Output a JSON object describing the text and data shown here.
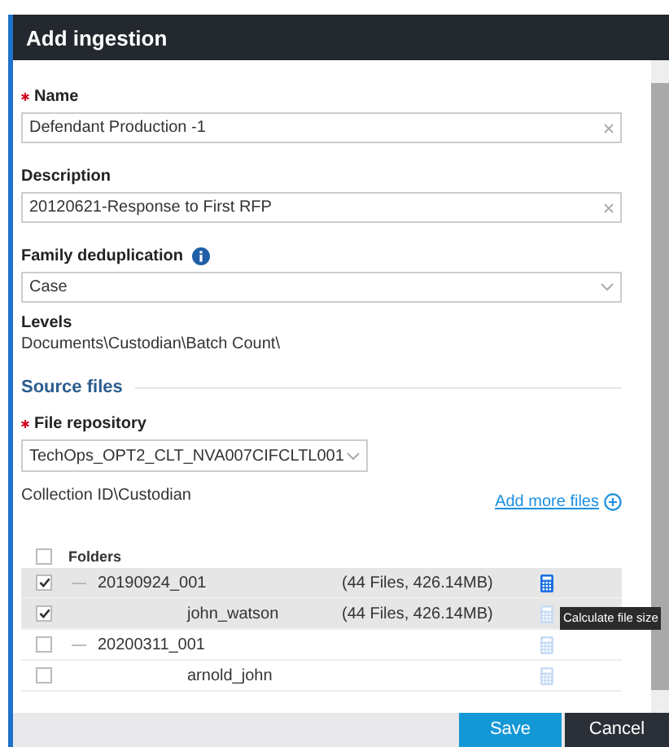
{
  "dialog": {
    "title": "Add ingestion"
  },
  "fields": [
    {
      "kind": "text",
      "label": "Name",
      "required": true,
      "value": "Defendant Production -1"
    },
    {
      "kind": "text",
      "label": "Description",
      "required": false,
      "value": "20120621-Response to First RFP"
    },
    {
      "kind": "select",
      "label": "Family deduplication",
      "required": false,
      "info": true,
      "value": "Case"
    }
  ],
  "levels": {
    "label": "Levels",
    "value": "Documents\\Custodian\\Batch Count\\"
  },
  "source_files": {
    "heading": "Source files",
    "repository": {
      "label": "File repository",
      "required": true,
      "value": "TechOps_OPT2_CLT_NVA007CIFCLTL001"
    },
    "path": "Collection ID\\Custodian",
    "add_link": "Add more files"
  },
  "folders": {
    "header": "Folders",
    "checked": false,
    "rows": [
      {
        "name": "20190924_001",
        "checked": true,
        "selected": true,
        "expanded": true,
        "info": "(44 Files, 426.14MB)",
        "calc_enabled": true,
        "children": [
          {
            "name": "john_watson",
            "checked": true,
            "selected": true,
            "info": "(44 Files, 426.14MB)",
            "calc_enabled": false
          }
        ]
      },
      {
        "name": "20200311_001",
        "checked": false,
        "selected": false,
        "expanded": true,
        "calc_enabled": false,
        "children": [
          {
            "name": "arnold_john",
            "checked": false,
            "selected": false,
            "calc_enabled": false
          }
        ]
      }
    ]
  },
  "tooltip": "Calculate file size",
  "buttons": [
    {
      "label": "Save",
      "kind": "primary"
    },
    {
      "label": "Cancel",
      "kind": "secondary"
    }
  ]
}
